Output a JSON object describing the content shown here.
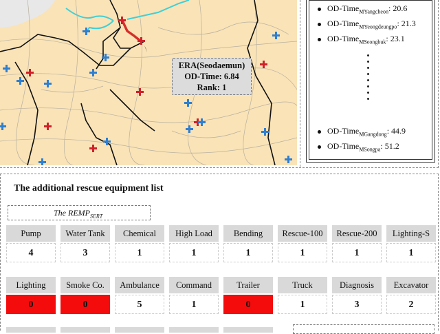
{
  "map": {
    "callout": {
      "title": "ERA(Seodaemun)",
      "od_time": "OD-Time: 6.84",
      "rank": "Rank: 1"
    },
    "colors": {
      "land": "#f9e3b7",
      "route": "#d3302a",
      "river": "#3fd0d6",
      "hospital_cross": "#2f7fd1",
      "station_cross": "#d0202a"
    }
  },
  "od_list": {
    "items": [
      {
        "prefix": "OD-Time",
        "sub": "MYangcheon",
        "value": ": 20.6"
      },
      {
        "prefix": "OD-Time",
        "sub": "MYeongdeungpo",
        "value": ": 21.3"
      },
      {
        "prefix": "OD-Time",
        "sub": "MSeongbuk",
        "value": ": 23.1"
      },
      {
        "prefix": "OD-Time",
        "sub": "MGangdong",
        "value": ": 44.9"
      },
      {
        "prefix": "OD-Time",
        "sub": "MSongpa",
        "value": ": 51.2"
      }
    ]
  },
  "equipment": {
    "title": "The additional rescue equipment list",
    "remp_prefix": "The REMP",
    "remp_sub": "SERT",
    "zero_color": "#f40c0c",
    "row1": [
      {
        "label": "Pump",
        "value": "4"
      },
      {
        "label": "Water Tank",
        "value": "3"
      },
      {
        "label": "Chemical",
        "value": "1"
      },
      {
        "label": "High Load",
        "value": "1"
      },
      {
        "label": "Bending",
        "value": "1"
      },
      {
        "label": "Rescue-100",
        "value": "1"
      },
      {
        "label": "Rescue-200",
        "value": "1"
      },
      {
        "label": "Lighting-S",
        "value": "1"
      }
    ],
    "row2": [
      {
        "label": "Lighting",
        "value": "0"
      },
      {
        "label": "Smoke Co.",
        "value": "0"
      },
      {
        "label": "Ambulance",
        "value": "5"
      },
      {
        "label": "Command",
        "value": "1"
      },
      {
        "label": "Trailer",
        "value": "0"
      },
      {
        "label": "Truck",
        "value": "1"
      },
      {
        "label": "Diagnosis",
        "value": "3"
      },
      {
        "label": "Excavator",
        "value": "2"
      }
    ]
  }
}
